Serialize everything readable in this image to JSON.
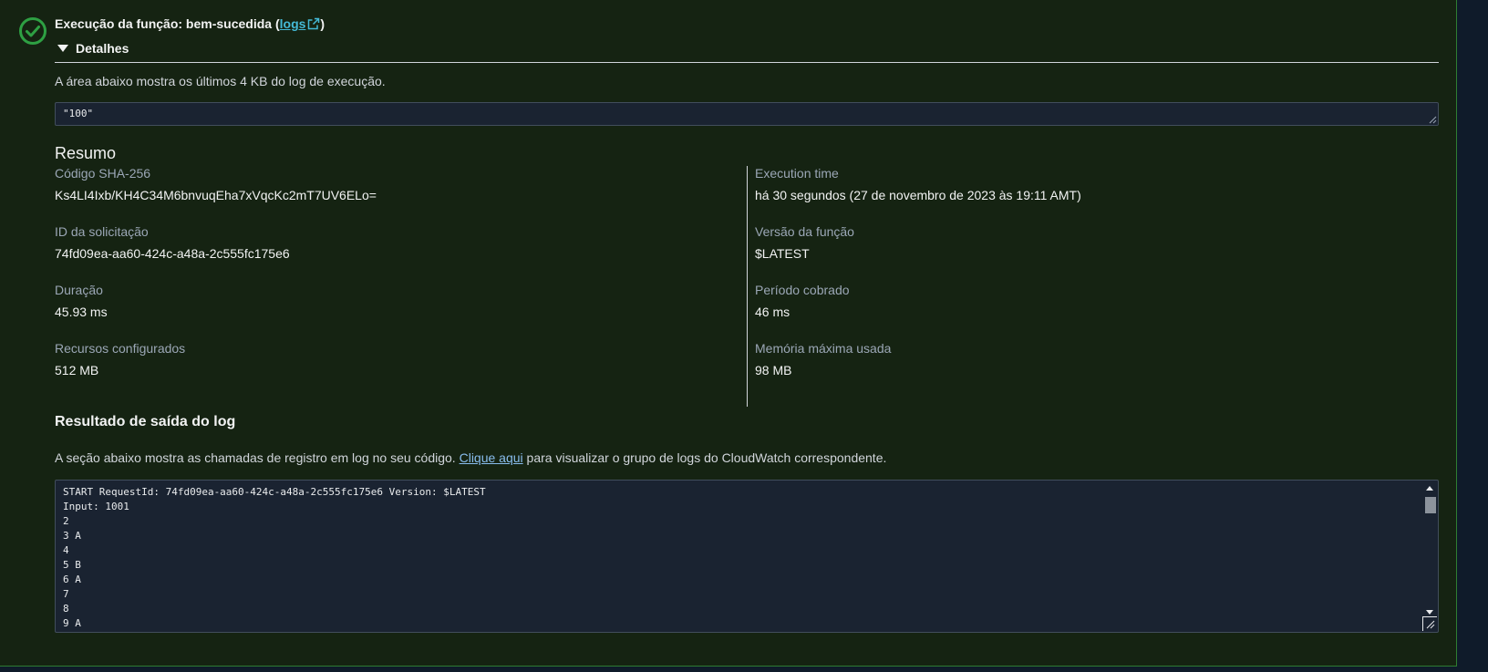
{
  "header": {
    "title_prefix": "Execução da função: bem-sucedida (",
    "logs_link": "logs",
    "title_suffix": ")",
    "status_icon": "check-circle-icon",
    "status_color": "#2ea043"
  },
  "details": {
    "toggle_label": "Detalhes",
    "description": "A área abaixo mostra os últimos 4 KB do log de execução.",
    "result_value": "\"100\""
  },
  "summary": {
    "title": "Resumo",
    "left": [
      {
        "label": "Código SHA-256",
        "value": "Ks4LI4Ixb/KH4C34M6bnvuqEha7xVqcKc2mT7UV6ELo="
      },
      {
        "label": "ID da solicitação",
        "value": "74fd09ea-aa60-424c-a48a-2c555fc175e6"
      },
      {
        "label": "Duração",
        "value": "45.93 ms"
      },
      {
        "label": "Recursos configurados",
        "value": "512 MB"
      }
    ],
    "right": [
      {
        "label": "Execution time",
        "value": "há 30 segundos (27 de novembro de 2023 às 19:11 AMT)"
      },
      {
        "label": "Versão da função",
        "value": "$LATEST"
      },
      {
        "label": "Período cobrado",
        "value": "46 ms"
      },
      {
        "label": "Memória máxima usada",
        "value": "98 MB"
      }
    ]
  },
  "log_output": {
    "title": "Resultado de saída do log",
    "desc_prefix": "A seção abaixo mostra as chamadas de registro em log no seu código. ",
    "desc_link": "Clique aqui",
    "desc_suffix": " para visualizar o grupo de logs do CloudWatch correspondente.",
    "lines": [
      "START RequestId: 74fd09ea-aa60-424c-a48a-2c555fc175e6 Version: $LATEST",
      "Input: 1001",
      "2",
      "3 A",
      "4",
      "5 B",
      "6 A",
      "7",
      "8",
      "9 A"
    ]
  }
}
